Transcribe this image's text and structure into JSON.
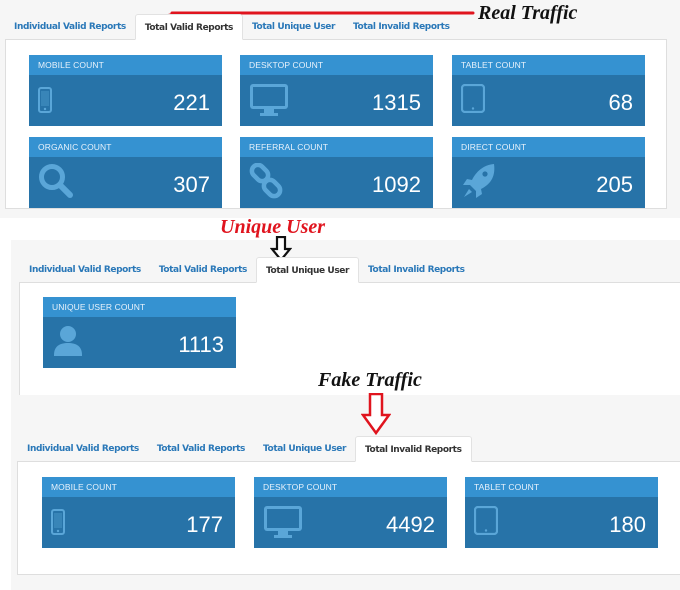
{
  "tabs": [
    "Individual Valid Reports",
    "Total Valid Reports",
    "Total Unique User",
    "Total Invalid Reports"
  ],
  "annotations": {
    "real_traffic": "Real Traffic",
    "unique_user": "Unique User",
    "fake_traffic": "Fake Traffic",
    "colors": {
      "red": "#e0141e",
      "black": "#111111"
    }
  },
  "sections": {
    "valid": {
      "active_tab": "Total Valid Reports",
      "cards": [
        {
          "label": "MOBILE COUNT",
          "value": "221",
          "icon": "mobile-icon"
        },
        {
          "label": "DESKTOP COUNT",
          "value": "1315",
          "icon": "desktop-icon"
        },
        {
          "label": "TABLET COUNT",
          "value": "68",
          "icon": "tablet-icon"
        },
        {
          "label": "ORGANIC COUNT",
          "value": "307",
          "icon": "search-icon"
        },
        {
          "label": "REFERRAL COUNT",
          "value": "1092",
          "icon": "link-icon"
        },
        {
          "label": "DIRECT COUNT",
          "value": "205",
          "icon": "rocket-icon"
        }
      ]
    },
    "unique": {
      "active_tab": "Total Unique User",
      "cards": [
        {
          "label": "UNIQUE USER COUNT",
          "value": "1113",
          "icon": "user-icon"
        }
      ]
    },
    "invalid": {
      "active_tab": "Total Invalid Reports",
      "cards": [
        {
          "label": "MOBILE COUNT",
          "value": "177",
          "icon": "mobile-icon"
        },
        {
          "label": "DESKTOP COUNT",
          "value": "4492",
          "icon": "desktop-icon"
        },
        {
          "label": "TABLET COUNT",
          "value": "180",
          "icon": "tablet-icon"
        }
      ]
    }
  },
  "colors": {
    "card_header": "#3592d1",
    "card_body": "#2773a8",
    "icon": "#5aa6d8",
    "tab_link": "#2a78b8"
  }
}
